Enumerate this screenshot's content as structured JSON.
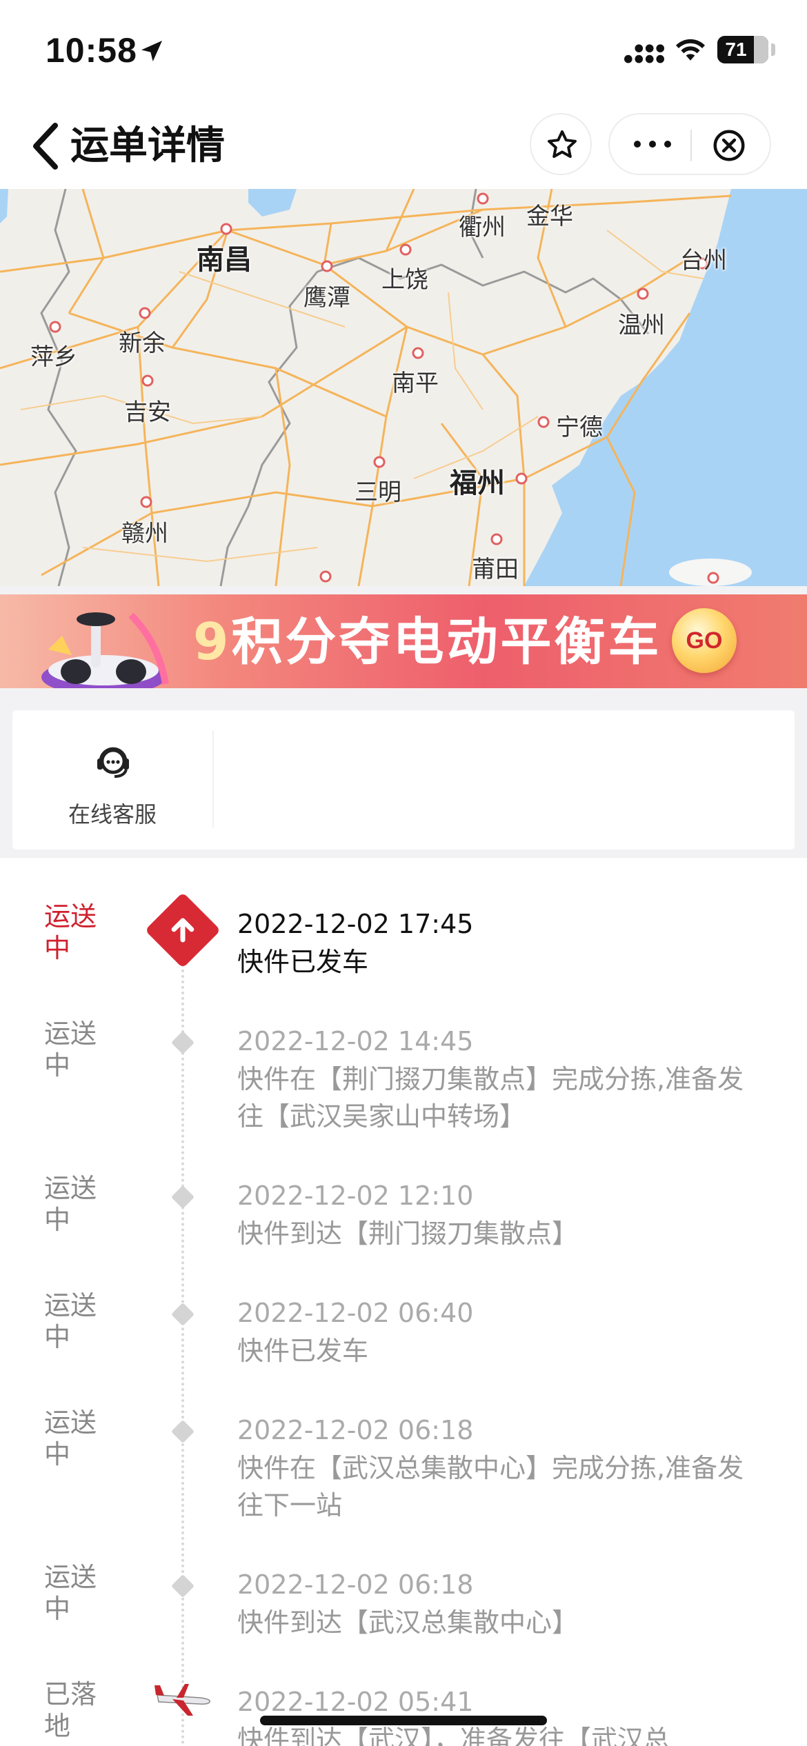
{
  "status_bar": {
    "time": "10:58",
    "battery_level": 71,
    "battery_text": "71"
  },
  "nav": {
    "title": "运单详情",
    "icons": [
      "back-chevron-icon",
      "star-icon",
      "more-dots-icon",
      "close-circle-icon"
    ]
  },
  "map": {
    "cities": [
      {
        "name": "南昌",
        "major": true
      },
      {
        "name": "衢州"
      },
      {
        "name": "金华"
      },
      {
        "name": "台州"
      },
      {
        "name": "上饶"
      },
      {
        "name": "鹰潭"
      },
      {
        "name": "温州"
      },
      {
        "name": "萍乡"
      },
      {
        "name": "新余"
      },
      {
        "name": "南平"
      },
      {
        "name": "吉安"
      },
      {
        "name": "宁德"
      },
      {
        "name": "福州",
        "major": true
      },
      {
        "name": "三明"
      },
      {
        "name": "赣州"
      },
      {
        "name": "莆田"
      }
    ],
    "colors": {
      "land": "#f1efea",
      "sea": "#a9d3f5",
      "road": "#f5b45a",
      "border": "#9a9a9a"
    }
  },
  "banner": {
    "number": "9",
    "text": "积分夺电动平衡车",
    "go_label": "GO"
  },
  "service": {
    "label": "在线客服",
    "icon": "customer-service-headset-icon"
  },
  "timeline": {
    "events": [
      {
        "status": "运送\n中",
        "time": "2022-12-02 17:45",
        "desc": "快件已发车",
        "active": true
      },
      {
        "status": "运送\n中",
        "time": "2022-12-02 14:45",
        "desc": "快件在【荆门掇刀集散点】完成分拣,准备发往【武汉吴家山中转场】"
      },
      {
        "status": "运送\n中",
        "time": "2022-12-02 12:10",
        "desc": "快件到达【荆门掇刀集散点】"
      },
      {
        "status": "运送\n中",
        "time": "2022-12-02 06:40",
        "desc": "快件已发车"
      },
      {
        "status": "运送\n中",
        "time": "2022-12-02 06:18",
        "desc": "快件在【武汉总集散中心】完成分拣,准备发往下一站"
      },
      {
        "status": "运送\n中",
        "time": "2022-12-02 06:18",
        "desc": "快件到达【武汉总集散中心】"
      },
      {
        "status": "已落\n地",
        "time": "2022-12-02 05:41",
        "desc": "快件到达【武汉】，准备发往【武汉总",
        "icon": "airplane-icon"
      }
    ]
  }
}
